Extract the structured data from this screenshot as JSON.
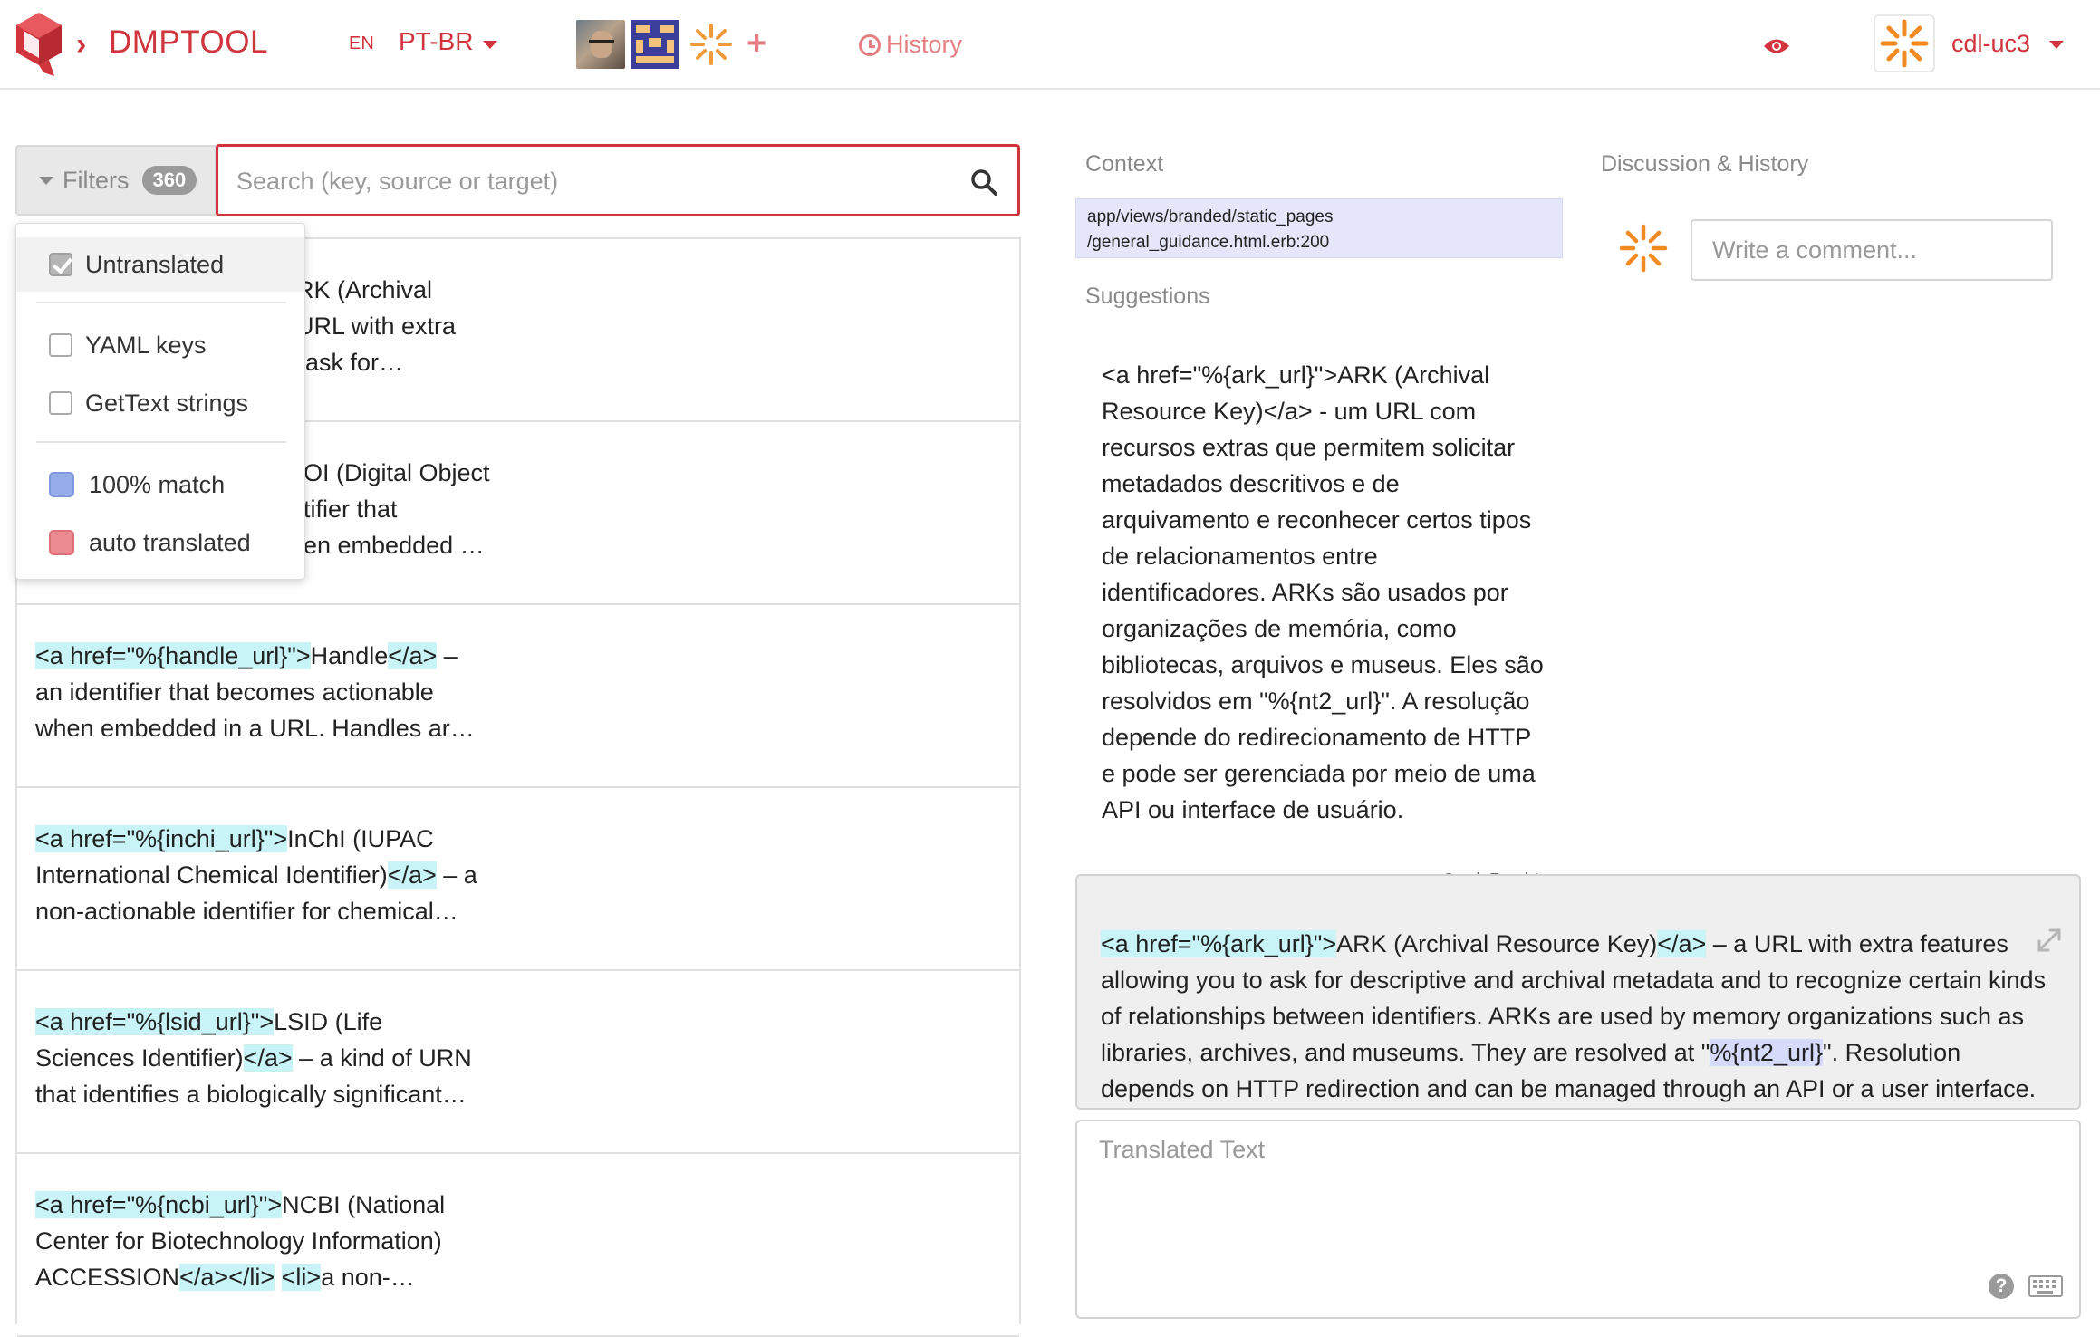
{
  "header": {
    "project_name": "DMPTOOL",
    "source_language": "EN",
    "target_language": "PT-BR",
    "add_member": "+",
    "history_label": "History",
    "user_name": "cdl-uc3"
  },
  "filters": {
    "label": "Filters",
    "count": "360",
    "search_placeholder": "Search (key, source or target)",
    "menu": {
      "untranslated": "Untranslated",
      "yaml_keys": "YAML keys",
      "gettext_strings": "GetText strings",
      "full_match": "100% match",
      "auto_translated": "auto translated"
    },
    "colors": {
      "full_match": "#97acea",
      "auto_translated": "#eb8a90"
    }
  },
  "strings": [
    {
      "line1_text": "RK (Archival",
      "line2_text": "URL with extra",
      "line3_text": "ask for…"
    },
    {
      "line1_text": "OI (Digital Object",
      "line2_text": "tifier that",
      "line3_text": "en embedded …"
    },
    {
      "tag_open": "<a href=\"%{handle_url}\">",
      "line1_text": "Handle",
      "tag_close": "</a>",
      "line1_rest": " –",
      "line2_text": "an identifier that becomes actionable",
      "line3_text": "when embedded in a URL. Handles ar…"
    },
    {
      "tag_open": "<a href=\"%{inchi_url}\">",
      "line1_text": "InChI (IUPAC",
      "line2_text": "International Chemical Identifier)",
      "tag_close": "</a>",
      "line2_rest": " – a",
      "line3_text": "non-actionable identifier for chemical…"
    },
    {
      "tag_open": "<a href=\"%{lsid_url}\">",
      "line1_text": "LSID (Life",
      "line2_text": "Sciences Identifier)",
      "tag_close": "</a>",
      "line2_rest": " – a kind of URN",
      "line3_text": "that identifies a biologically significant…"
    },
    {
      "tag_open": "<a href=\"%{ncbi_url}\">",
      "line1_text": "NCBI (National",
      "line2_text": "Center for Biotechnology Information)",
      "line3_text": "ACCESSION",
      "tag_close": "</a></li>",
      "tag_li": "<li>",
      "line3_rest": "a non-…"
    }
  ],
  "context": {
    "label": "Context",
    "path_line1": "app/views/branded/static_pages",
    "path_line2": "/general_guidance.html.erb:200"
  },
  "suggestions": {
    "label": "Suggestions",
    "text": "<a href=\"%{ark_url}\">ARK (Archival Resource Key)</a> - um URL com recursos extras que permitem solicitar metadados descritivos e de arquivamento e reconhecer certos tipos de relacionamentos entre identificadores. ARKs são usados por organizações de memória, como bibliotecas, arquivos e museus. Eles são resolvidos em \"%{nt2_url}\". A resolução depende do redirecionamento de HTTP e pode ser gerenciada por meio de uma API ou interface de usuário.",
    "credit": "Google Translate"
  },
  "discussion": {
    "label": "Discussion & History",
    "comment_placeholder": "Write a comment..."
  },
  "source": {
    "tag_open": "<a href=\"%{ark_url}\">",
    "text_1": "ARK (Archival Resource Key)",
    "tag_close": "</a>",
    "text_2": " – a URL with extra features allowing you to ask for descriptive and archival metadata and to recognize certain kinds of relationships between identifiers. ARKs are used by memory organizations such as libraries, archives, and museums. They are resolved at \"",
    "var_nt2": "%{nt2_url}",
    "text_3": "\". Resolution depends on HTTP redirection and can be managed through an API or a user interface."
  },
  "translation": {
    "placeholder": "Translated Text",
    "help": "?"
  },
  "icons": {
    "logo": "dmptool-logo-icon",
    "search": "search-icon",
    "history": "clock-icon",
    "eye": "eye-icon",
    "expand": "expand-icon",
    "help": "help-icon",
    "keyboard": "keyboard-icon"
  },
  "colors": {
    "accent": "#d0343c",
    "accent_light": "#e57e82",
    "tag_highlight": "#c8f3f7",
    "variable_highlight": "#d7dbfb",
    "context_bg": "#e6e6fb"
  }
}
